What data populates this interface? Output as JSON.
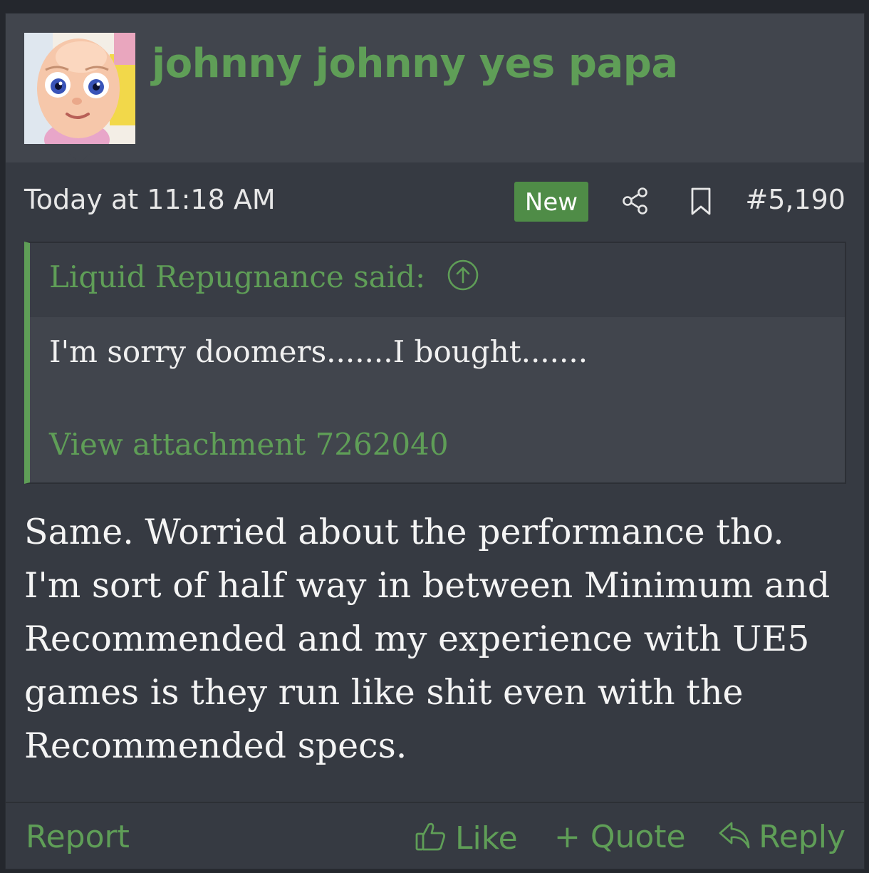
{
  "post": {
    "username": "johnny johnny yes papa",
    "timestamp": "Today at 11:18 AM",
    "new_badge": "New",
    "post_number": "#5,190",
    "icons": {
      "share": "share-icon",
      "bookmark": "bookmark-icon",
      "quote_up": "arrow-up-circle-icon",
      "like": "thumbs-up-icon",
      "reply": "reply-icon"
    },
    "quote": {
      "author": "Liquid Repugnance said:",
      "text": "I'm sorry doomers.......I bought.......",
      "attachment": "View attachment 7262040"
    },
    "body": "Same. Worried about the performance tho. I'm sort of half way in between Minimum and Recommended and my experience with UE5 games is they run like shit even with the Recommended specs.",
    "actions": {
      "report": "Report",
      "like": "Like",
      "quote": "+ Quote",
      "reply": "Reply"
    }
  },
  "colors": {
    "accent": "#5f9e57",
    "badge": "#4f8c47",
    "background": "#363a42",
    "header": "#41454d",
    "text": "#f4f4f4"
  }
}
